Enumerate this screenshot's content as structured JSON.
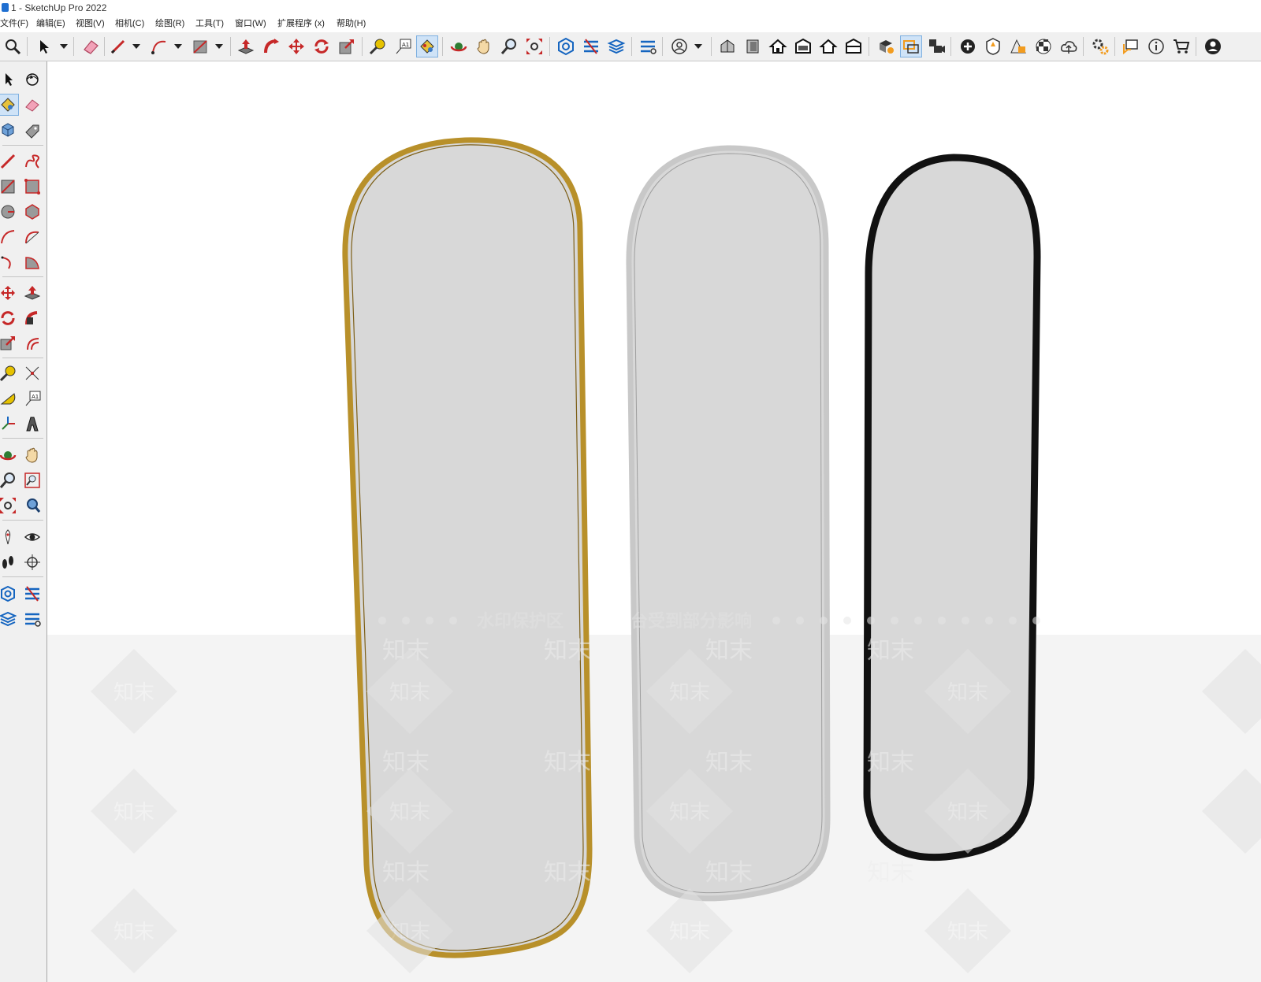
{
  "window": {
    "title": "1 - SketchUp Pro 2022"
  },
  "menu": [
    "文件(F)",
    "编辑(E)",
    "视图(V)",
    "相机(C)",
    "绘图(R)",
    "工具(T)",
    "窗口(W)",
    "扩展程序 (x)",
    "帮助(H)"
  ],
  "watermark": {
    "banner": "水印保护区",
    "banner2": "台受到部分影响",
    "tile": "知末"
  },
  "mirrors": [
    {
      "name": "gold-frame-mirror",
      "frame_color": "#b8902a"
    },
    {
      "name": "silver-frame-mirror",
      "frame_color": "#c8c8c8"
    },
    {
      "name": "black-frame-mirror",
      "frame_color": "#111111"
    }
  ],
  "colors": {
    "glass": "#d8d8d8",
    "toolbar_bg": "#f0f0f0",
    "active_tool": "#cfe3f7",
    "ground": "#f4f4f4"
  },
  "active_tool": "paint-bucket"
}
